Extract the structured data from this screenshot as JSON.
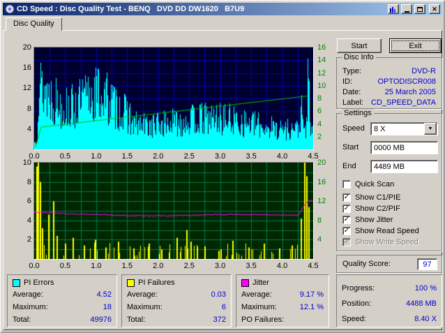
{
  "window": {
    "title": "CD Speed : Disc Quality Test - BENQ   DVD DD DW1620   B7U9"
  },
  "tabs": [
    {
      "label": "Disc Quality"
    }
  ],
  "actions": {
    "start": "Start",
    "exit": "Exit"
  },
  "disc_info": {
    "title": "Disc Info",
    "rows": [
      {
        "label": "Type:",
        "value": "DVD-R"
      },
      {
        "label": "ID:",
        "value": "OPTODISCR008"
      },
      {
        "label": "Date:",
        "value": "25 March 2005"
      },
      {
        "label": "Label:",
        "value": "CD_SPEED_DATA"
      }
    ]
  },
  "settings": {
    "title": "Settings",
    "speed_label": "Speed",
    "speed_value": "8 X",
    "start_label": "Start",
    "start_value": "0000 MB",
    "end_label": "End",
    "end_value": "4489 MB",
    "checkboxes": [
      {
        "label": "Quick Scan",
        "checked": false,
        "disabled": false
      },
      {
        "label": "Show C1/PIE",
        "checked": true,
        "disabled": false
      },
      {
        "label": "Show C2/PIF",
        "checked": true,
        "disabled": false
      },
      {
        "label": "Show Jitter",
        "checked": true,
        "disabled": false
      },
      {
        "label": "Show Read Speed",
        "checked": true,
        "disabled": false
      },
      {
        "label": "Show Write Speed",
        "checked": true,
        "disabled": true
      }
    ]
  },
  "quality": {
    "label": "Quality Score:",
    "value": "97"
  },
  "status": {
    "rows": [
      {
        "label": "Progress:",
        "value": "100 %"
      },
      {
        "label": "Position:",
        "value": "4488 MB"
      },
      {
        "label": "Speed:",
        "value": "8.40 X"
      }
    ]
  },
  "legend_boxes": [
    {
      "name": "PI Errors",
      "swatch": "#00ffff",
      "rows": [
        {
          "label": "Average:",
          "value": "4.52"
        },
        {
          "label": "Maximum:",
          "value": "18"
        },
        {
          "label": "Total:",
          "value": "49976"
        }
      ]
    },
    {
      "name": "PI Failures",
      "swatch": "#ffff00",
      "rows": [
        {
          "label": "Average:",
          "value": "0.03"
        },
        {
          "label": "Maximum:",
          "value": "6"
        },
        {
          "label": "Total:",
          "value": "372"
        }
      ]
    },
    {
      "name": "Jitter",
      "swatch": "#ff00ff",
      "rows": [
        {
          "label": "Average:",
          "value": "9.17 %"
        },
        {
          "label": "Maximum:",
          "value": "12.1 %"
        },
        {
          "label": "PO Failures:",
          "value": ""
        }
      ]
    }
  ],
  "colors": {
    "value_text": "#0000cd",
    "window_bg": "#d4d0c8",
    "titlebar_left": "#0a246a",
    "titlebar_right": "#a6caf0"
  },
  "chart_data": [
    {
      "id": "chart-pi-errors",
      "type": "bar",
      "title": "PI Errors (cyan spikes) with Read Speed overlay (green line)",
      "x": {
        "min": 0,
        "max": 4.5,
        "unit": "GB",
        "ticks": [
          "0.0",
          "0.5",
          "1.0",
          "1.5",
          "2.0",
          "2.5",
          "3.0",
          "3.5",
          "4.0",
          "4.5"
        ]
      },
      "y_left": {
        "min": 0,
        "max": 20,
        "ticks": [
          "20",
          "16",
          "12",
          "8",
          "4"
        ]
      },
      "y_right": {
        "min": 0,
        "max": 16,
        "color": "#008000",
        "ticks": [
          "16",
          "14",
          "12",
          "10",
          "8",
          "6",
          "4",
          "2"
        ]
      },
      "bg": "#000030",
      "grid": "#0000b0",
      "seed": 13,
      "series": [
        {
          "name": "PI Errors",
          "color": "#00ffff",
          "average": 4.52,
          "maximum": 18,
          "total": 49976,
          "shape": "dense spikes 8-19 high from 0.0-1.5 GB, declining to 5-9 after 2 GB, tall spikes ~11 at 4.3 GB and ~19 at 4.42 GB"
        },
        {
          "name": "Read Speed",
          "color": "#00c000",
          "unit": "X",
          "start_value": 3.5,
          "end_value": 8.4
        }
      ]
    },
    {
      "id": "chart-pi-failures",
      "type": "bar",
      "title": "PI Failures (yellow spikes) with Jitter overlay (magenta line)",
      "x": {
        "min": 0,
        "max": 4.5,
        "unit": "GB",
        "ticks": [
          "0.0",
          "0.5",
          "1.0",
          "1.5",
          "2.0",
          "2.5",
          "3.0",
          "3.5",
          "4.0",
          "4.5"
        ]
      },
      "y_left": {
        "min": 0,
        "max": 10,
        "ticks": [
          "10",
          "8",
          "6",
          "4",
          "2"
        ]
      },
      "y_right": {
        "min": 0,
        "max": 20,
        "color": "#008000",
        "ticks": [
          "20",
          "16",
          "12",
          "8",
          "4"
        ]
      },
      "bg": "#002800",
      "grid": "#007850",
      "seed": 99,
      "series": [
        {
          "name": "PI Failures",
          "color": "#ffff00",
          "average": 0.03,
          "maximum": 6,
          "total": 372,
          "spikes": [
            [
              0.03,
              9.6
            ],
            [
              0.055,
              10
            ],
            [
              0.09,
              8.0
            ],
            [
              0.12,
              3.2
            ],
            [
              0.22,
              4.6
            ],
            [
              0.3,
              6.0
            ],
            [
              0.36,
              2.4
            ],
            [
              0.5,
              1.6
            ],
            [
              0.62,
              2.2
            ],
            [
              0.8,
              1.4
            ],
            [
              0.98,
              2.0
            ],
            [
              1.15,
              1.2
            ],
            [
              1.35,
              1.8
            ],
            [
              1.6,
              1.1
            ],
            [
              1.85,
              1.6
            ],
            [
              2.05,
              1.0
            ],
            [
              2.3,
              2.2
            ],
            [
              2.45,
              3.0
            ],
            [
              2.52,
              1.8
            ],
            [
              2.75,
              1.3
            ],
            [
              3.0,
              1.0
            ],
            [
              3.2,
              1.9
            ],
            [
              3.45,
              1.2
            ],
            [
              3.7,
              1.6
            ],
            [
              3.95,
              1.1
            ],
            [
              4.15,
              1.4
            ],
            [
              4.3,
              4.2
            ],
            [
              4.35,
              10
            ],
            [
              4.385,
              8.6
            ],
            [
              4.42,
              5.4
            ]
          ]
        },
        {
          "name": "Jitter",
          "color": "#ff00ff",
          "unit": "%",
          "average": 9.17,
          "maximum": 12.1
        }
      ]
    }
  ]
}
